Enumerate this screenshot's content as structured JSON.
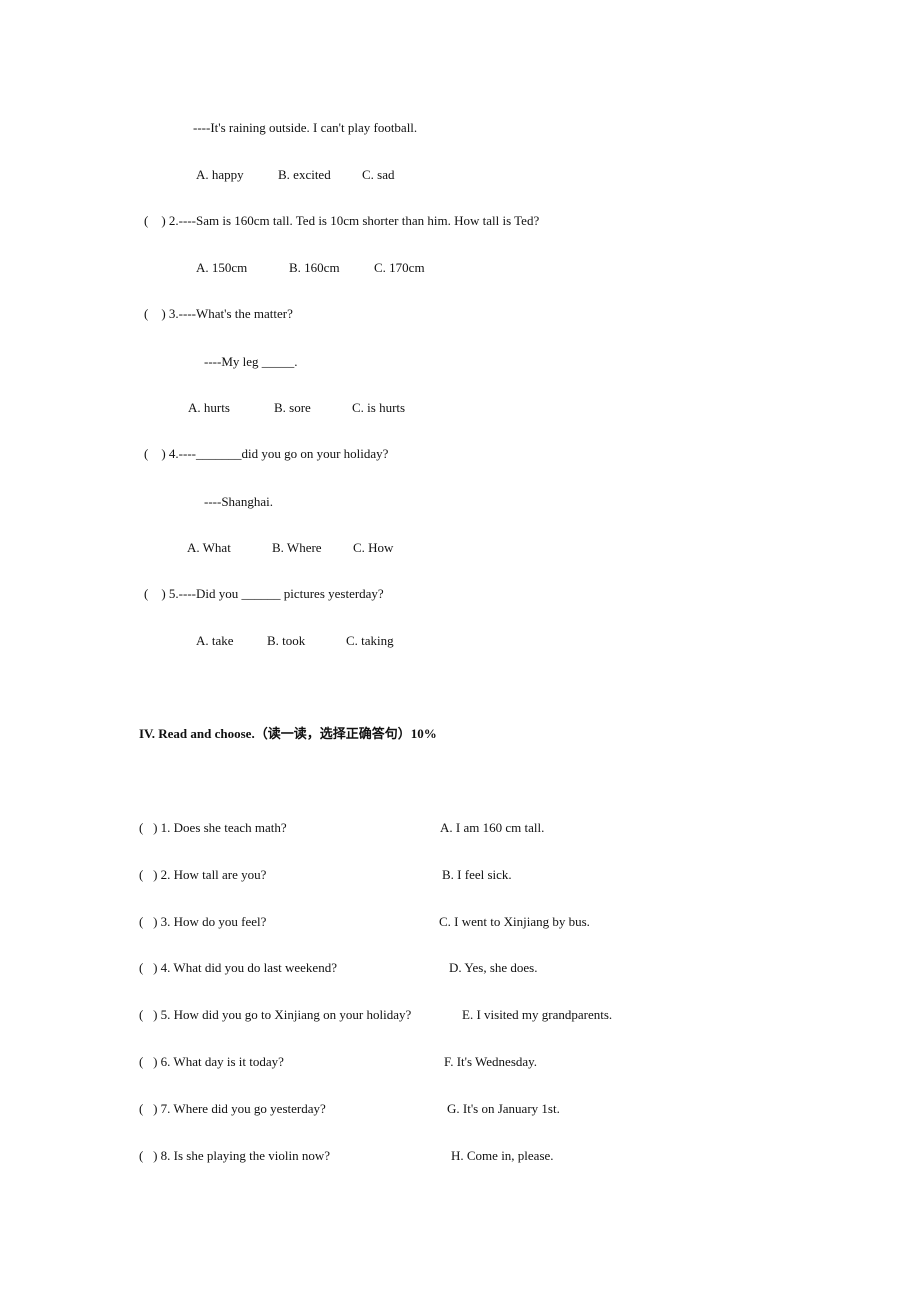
{
  "section3": {
    "q1": {
      "dialog": "----It's raining outside. I can't play football.",
      "options": [
        "A. happy",
        "B. excited",
        "C. sad"
      ]
    },
    "q2": {
      "question": "(    ) 2.----Sam is 160cm tall. Ted is 10cm shorter than him. How tall is Ted?",
      "options": [
        "A. 150cm",
        "B. 160cm",
        "C. 170cm"
      ]
    },
    "q3": {
      "question": "(    ) 3.----What's the matter?",
      "reply": "----My leg _____.",
      "options": [
        "A. hurts",
        "B. sore",
        "C. is hurts"
      ]
    },
    "q4": {
      "question": "(    ) 4.----_______did you go on your holiday?",
      "reply": "----Shanghai.",
      "options": [
        "A. What",
        "B. Where",
        "C. How"
      ]
    },
    "q5": {
      "question": "(    ) 5.----Did you ______ pictures yesterday?",
      "options": [
        "A. take",
        "B. took",
        "C. taking"
      ]
    }
  },
  "section4": {
    "title": "IV. Read and choose.（读一读，选择正确答句）10%",
    "questions": [
      "(   ) 1. Does she teach math?",
      "(   ) 2. How tall are you?",
      "(   ) 3. How do you feel?",
      "(   ) 4. What did you do last weekend?",
      "(   ) 5. How did you go to Xinjiang on your holiday?",
      "(   ) 6. What day is it today?",
      "(   ) 7. Where did you go yesterday?",
      "(   ) 8. Is she playing the violin now?"
    ],
    "answers": [
      "A. I am 160 cm tall.",
      "B. I feel sick.",
      "C. I went to Xinjiang by bus.",
      "D. Yes, she does.",
      "E. I visited my grandparents.",
      "F. It's Wednesday.",
      "G. It's on January 1st.",
      "H. Come in, please."
    ]
  }
}
